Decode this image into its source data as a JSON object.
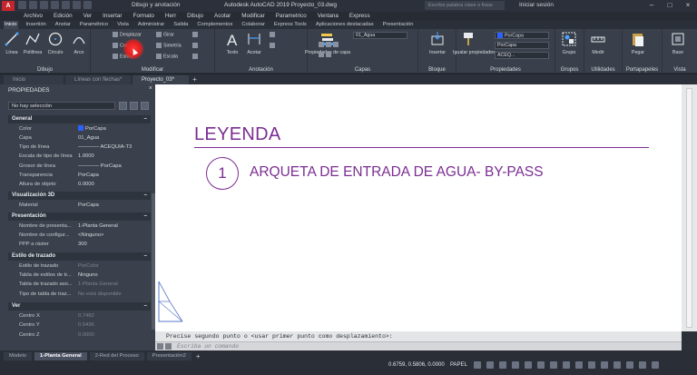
{
  "titlebar": {
    "app_icon": "A",
    "workspace": "Dibujo y anotación",
    "title": "Autodesk AutoCAD 2019   Proyecto_03.dwg",
    "search_placeholder": "Escriba palabra clave o frase",
    "signin": "Iniciar sesión"
  },
  "menubar": {
    "items": [
      "Archivo",
      "Edición",
      "Ver",
      "Insertar",
      "Formato",
      "Herr",
      "Dibujo",
      "Acotar",
      "Modificar",
      "Parametrico",
      "Ventana",
      "Express"
    ]
  },
  "ribbon_tabs": {
    "items": [
      "Inicio",
      "Insertión",
      "Anotar",
      "Paramétrico",
      "Vista",
      "Administrar",
      "Salida",
      "Complementos",
      "Colaborar",
      "Express Tools",
      "Aplicaciones destacadas",
      "Presentación"
    ],
    "active": "Inicio"
  },
  "ribbon": {
    "dibujo": {
      "label": "Dibujo",
      "tools": [
        "Línea",
        "Polilínea",
        "Círculo",
        "Arco"
      ]
    },
    "modificar": {
      "label": "Modificar",
      "rows": [
        "Desplazar",
        "Girar",
        "Copiar",
        "Simetría",
        "Estirar",
        "Escala"
      ]
    },
    "anotacion": {
      "label": "Anotación",
      "tools": [
        "Texto",
        "Acotar"
      ]
    },
    "capas": {
      "label": "Capas",
      "props_label": "Propiedades de capa",
      "layer_dropdown": "01_Agua"
    },
    "bloque": {
      "label": "Bloque",
      "tool": "Insertar"
    },
    "propiedades": {
      "label": "Propiedades",
      "tool": "Igualar propiedades",
      "color": "PorCapa",
      "linetype": "PorCapa",
      "lineweight": "ACEQ..."
    },
    "grupos": {
      "label": "Grupos",
      "tool": "Grupo"
    },
    "utilidades": {
      "label": "Utilidades",
      "tool": "Medir"
    },
    "portapapeles": {
      "label": "Portapapeles",
      "tool": "Pegar"
    },
    "vista": {
      "label": "Vista",
      "tool": "Base"
    }
  },
  "file_tabs": {
    "items": [
      "Inicio",
      "Líneas con flechas*",
      "Proyecto_03*"
    ],
    "active": "Proyecto_03*"
  },
  "properties": {
    "title": "PROPIEDADES",
    "selection": "No hay selección",
    "sections": {
      "general": "General",
      "vis3d": "Visualización 3D",
      "presentacion": "Presentación",
      "trazado": "Estilo de trazado",
      "ver": "Ver"
    },
    "general_rows": [
      {
        "key": "Color",
        "value": "PorCapa"
      },
      {
        "key": "Capa",
        "value": "01_Agua"
      },
      {
        "key": "Tipo de línea",
        "value": "———— ACEQUIA-T3"
      },
      {
        "key": "Escala de tipo de línea",
        "value": "1.0000"
      },
      {
        "key": "Grosor de línea",
        "value": "———— PorCapa"
      },
      {
        "key": "Transparencia",
        "value": "PorCapa"
      },
      {
        "key": "Altura de objeto",
        "value": "0.0000"
      }
    ],
    "vis3d_rows": [
      {
        "key": "Material",
        "value": "PorCapa"
      }
    ],
    "presentacion_rows": [
      {
        "key": "Nombre de presenta...",
        "value": "1-Planta General"
      },
      {
        "key": "Nombre de configur...",
        "value": "<Ninguno>"
      },
      {
        "key": "PPP a ráster",
        "value": "300"
      }
    ],
    "trazado_rows": [
      {
        "key": "Estilo de trazado",
        "value": "PorColor"
      },
      {
        "key": "Tabla de estilos de tr...",
        "value": "Ninguno"
      },
      {
        "key": "Tabla de trazado aso...",
        "value": "1-Planta General"
      },
      {
        "key": "Tipo de tabla de traz...",
        "value": "No está disponible"
      }
    ],
    "ver_rows": [
      {
        "key": "Centro X",
        "value": "0.7482"
      },
      {
        "key": "Centro Y",
        "value": "0.5436"
      },
      {
        "key": "Centro Z",
        "value": "0.0000"
      }
    ]
  },
  "canvas": {
    "legend_title": "LEYENDA",
    "item_number": "1",
    "item_text": "ARQUETA DE ENTRADA DE AGUA- BY-PASS",
    "accent_color": "#7b2d92"
  },
  "command": {
    "history": "Precise segundo punto o <usar primer punto como desplazamiento>:",
    "placeholder": "Escriba un comando"
  },
  "layout_tabs": {
    "items": [
      "Modelo",
      "1-Planta General",
      "2-Red del Proceso",
      "Presentación2"
    ],
    "active": "1-Planta General"
  },
  "status": {
    "coords": "0.6759, 0.5806, 0.0000",
    "paper": "PAPEL"
  }
}
